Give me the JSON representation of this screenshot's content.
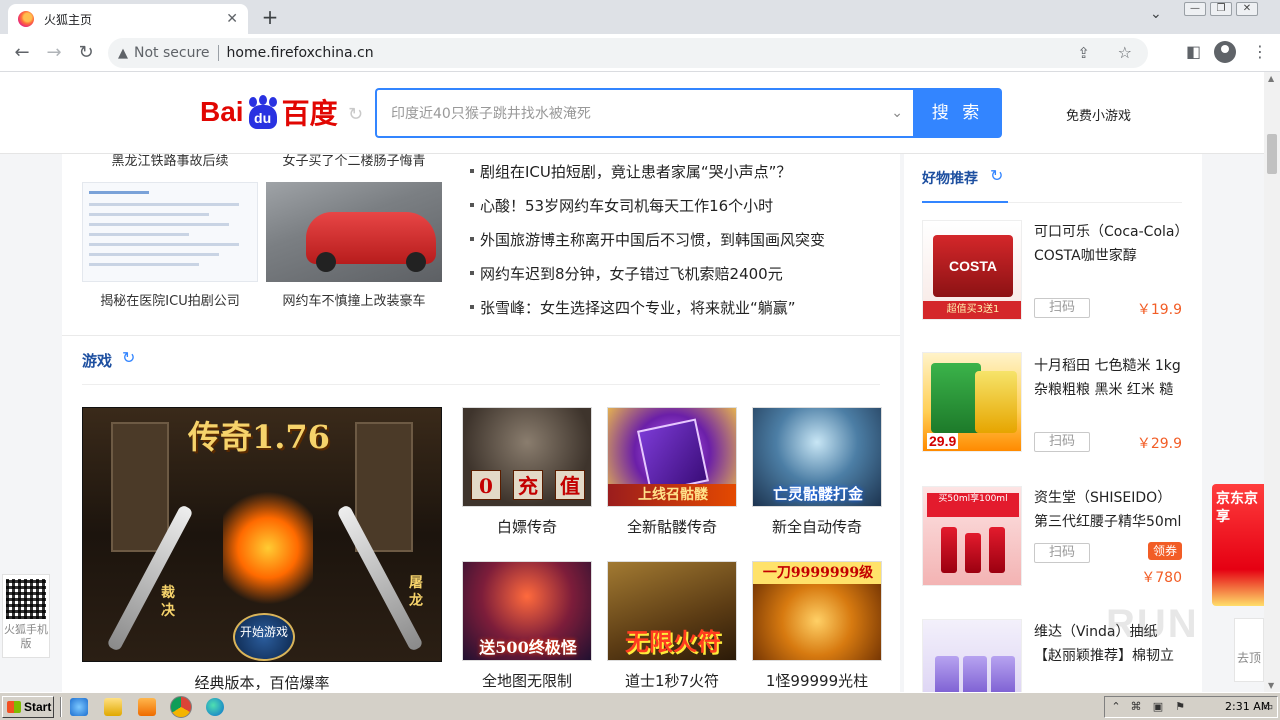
{
  "browser": {
    "tab_title": "火狐主页",
    "tab_close": "✕",
    "new_tab": "+",
    "not_secure": "Not secure",
    "url": "home.firefoxchina.cn",
    "window_controls": {
      "minimize": "—",
      "restore": "❐",
      "close": "✕"
    }
  },
  "header": {
    "logo_bai": "Bai",
    "logo_du": "du",
    "logo_cn": "百度",
    "search_placeholder": "印度近40只猴子跳井找水被淹死",
    "search_button": "搜 索",
    "games_link": "免费小游戏"
  },
  "news": {
    "top_captions": [
      "黑龙江铁路事故后续",
      "女子买了个二楼肠子悔青"
    ],
    "image_captions": [
      "揭秘在医院ICU拍剧公司",
      "网约车不慎撞上改装豪车"
    ],
    "headlines": [
      "剧组在ICU拍短剧，竟让患者家属“哭小声点”？",
      "心酸！53岁网约车女司机每天工作16个小时",
      "外国旅游博主称离开中国后不习惯，到韩国画风突变",
      "网约车迟到8分钟，女子错过飞机索赔2400元",
      "张雪峰：女生选择这四个专业，将来就业“躺赢”"
    ]
  },
  "games": {
    "section_title": "游戏",
    "featured": {
      "title": "传奇1.76",
      "side_left": "裁决",
      "side_right": "屠龙",
      "start": "开始游戏",
      "caption": "经典版本，百倍爆率"
    },
    "items": [
      {
        "caption": "白嫖传奇",
        "art": [
          "0",
          "充",
          "值"
        ]
      },
      {
        "caption": "全新骷髅传奇",
        "art": "上线召骷髅"
      },
      {
        "caption": "新全自动传奇",
        "art": "亡灵骷髅打金"
      },
      {
        "caption": "全地图无限制",
        "art": "送500终极怪"
      },
      {
        "caption": "道士1秒7火符",
        "art": "无限火符"
      },
      {
        "caption": "1怪99999光柱",
        "art": "一刀9999999级"
      }
    ]
  },
  "products": {
    "section_title": "好物推荐",
    "scan_label": "扫码",
    "items": [
      {
        "name": "可口可乐（Coca-Cola）COSTA咖世家醇",
        "price": "￥19.9",
        "art": "COSTA",
        "promo": "超值买3送1"
      },
      {
        "name": "十月稻田 七色糙米 1kg 杂粮粗粮 黑米 红米 糙",
        "price": "￥29.9",
        "art": "29.9"
      },
      {
        "name": "资生堂（SHISEIDO）第三代红腰子精华50ml",
        "price": "￥780",
        "coupon": "领券",
        "art": "买50ml享100ml"
      },
      {
        "name": "维达（Vinda）抽纸 【赵丽颖推荐】棉韧立",
        "price": ""
      }
    ]
  },
  "floating": {
    "qr_label": "火狐手机版",
    "side_ad": "京东京享",
    "goto_top": "去顶",
    "watermark": "RUN"
  },
  "taskbar": {
    "start": "Start",
    "clock": "2:31 AM"
  }
}
